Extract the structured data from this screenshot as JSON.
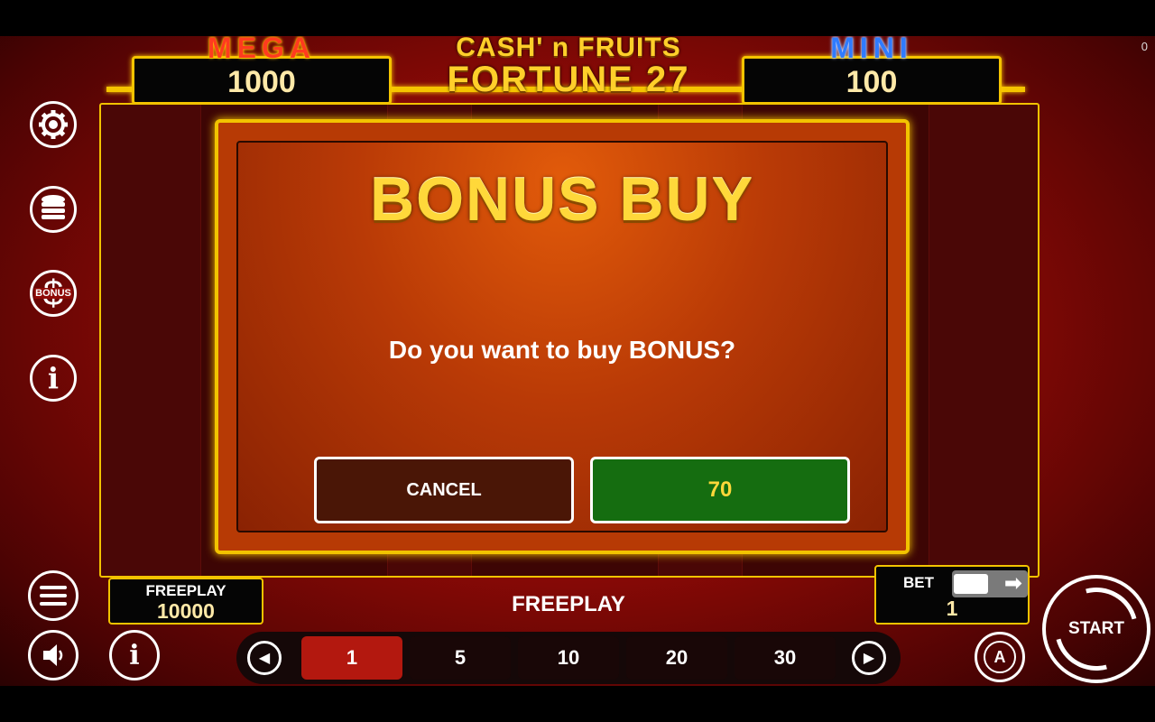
{
  "corner_counter": "0",
  "jackpots": {
    "mega": {
      "label": "MEGA",
      "value": "1000"
    },
    "mini": {
      "label": "MINI",
      "value": "100"
    }
  },
  "logo": {
    "line1": "CASH' n FRUITS",
    "line2": "FORTUNE 27"
  },
  "side_icons": [
    {
      "name": "settings-gear-icon"
    },
    {
      "name": "coins-stack-icon"
    },
    {
      "name": "bonus-dollar-icon",
      "label": "BONUS"
    },
    {
      "name": "info-icon"
    }
  ],
  "dialog": {
    "title": "BONUS BUY",
    "question": "Do you want to buy BONUS?",
    "cancel_label": "CANCEL",
    "buy_label": "70"
  },
  "credit": {
    "label": "FREEPLAY",
    "value": "10000"
  },
  "status_text": "FREEPLAY",
  "bet": {
    "label": "BET",
    "value": "1"
  },
  "bet_options": [
    "1",
    "5",
    "10",
    "20",
    "30"
  ],
  "bet_selected": "1",
  "start_label": "START",
  "auto_label": "A",
  "colors": {
    "gold": "#f2c300",
    "dialog_orange": "#b93a06",
    "buy_green": "#156d10",
    "selected_red": "#b3180f"
  }
}
